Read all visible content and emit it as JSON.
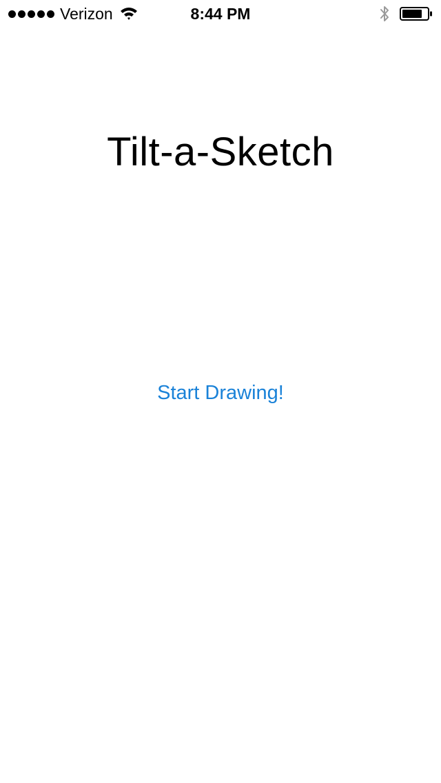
{
  "status_bar": {
    "carrier": "Verizon",
    "time": "8:44 PM",
    "signal_bars": 5,
    "icons": [
      "wifi-icon",
      "bluetooth-icon",
      "battery-icon"
    ],
    "battery_level": 0.8
  },
  "main": {
    "title": "Tilt-a-Sketch",
    "start_button_label": "Start Drawing!"
  },
  "colors": {
    "background": "#ffffff",
    "text": "#000000",
    "accent": "#1a82d8",
    "status_icon_gray": "#9a9a9a"
  }
}
